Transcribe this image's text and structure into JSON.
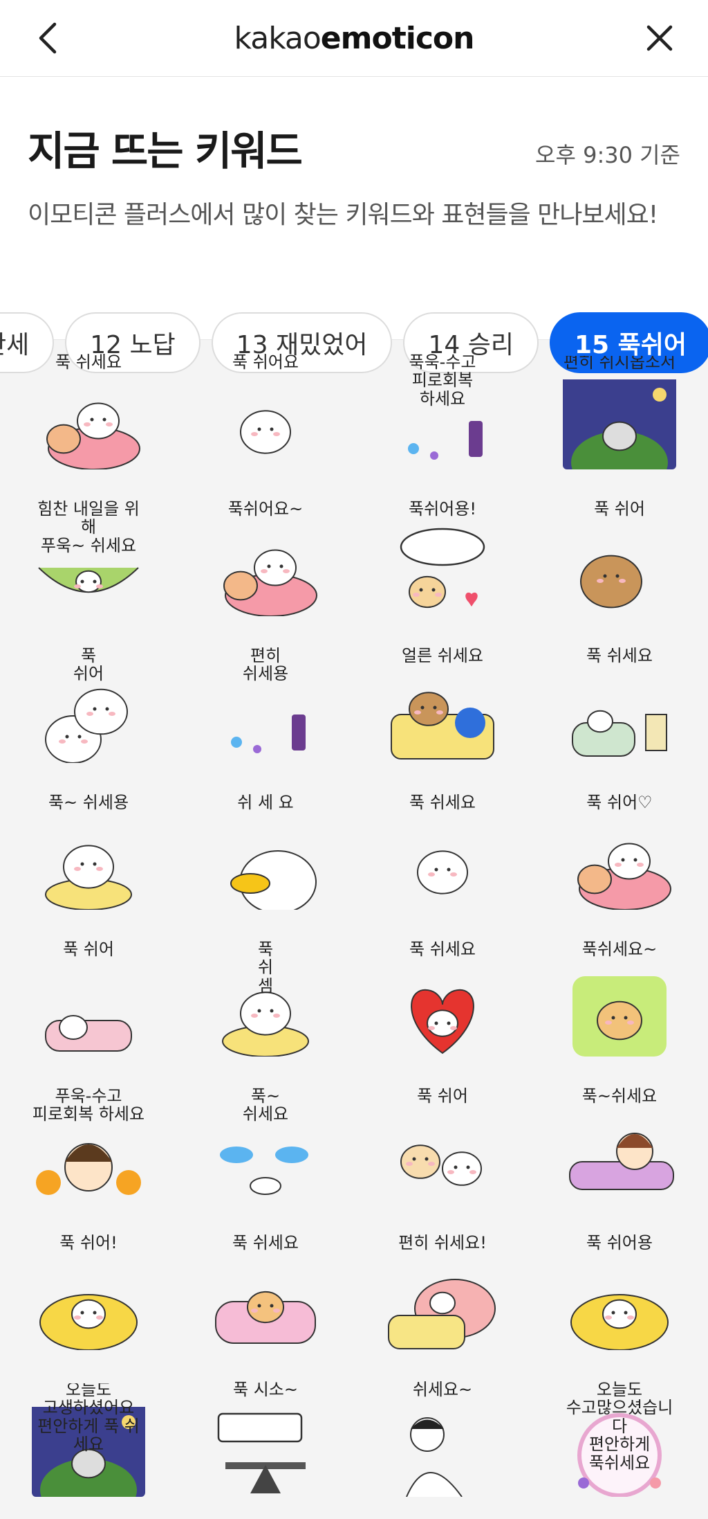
{
  "nav": {
    "brand_light": "kakao",
    "brand_bold": "emoticon"
  },
  "header": {
    "title": "지금 뜨는 키워드",
    "timestamp": "오후 9:30 기준",
    "subtitle": "이모티콘 플러스에서 많이 찾는 키워드와 표현들을 만나보세요!"
  },
  "chips": [
    {
      "label": "만세",
      "active": false
    },
    {
      "label": "12 노답",
      "active": false
    },
    {
      "label": "13 재밌었어",
      "active": false
    },
    {
      "label": "14 승리",
      "active": false
    },
    {
      "label": "15 푹쉬어",
      "active": true
    }
  ],
  "stickers": [
    {
      "caption": "푹 쉬세요",
      "art": "bear-bed"
    },
    {
      "caption": "푹 쉬어요",
      "art": "bear-cushion"
    },
    {
      "caption": "푹욱-수고\n피로회복\n하세요",
      "art": "text-drink"
    },
    {
      "caption": "편히 쉬시옵소서",
      "art": "night-sleeper"
    },
    {
      "caption": "힘찬 내일을 위해\n푸욱~ 쉬세요",
      "art": "hammock"
    },
    {
      "caption": "푹쉬어요~",
      "art": "bear-hug"
    },
    {
      "caption": "푹쉬어용!",
      "art": "puppy-bubble"
    },
    {
      "caption": "푹 쉬어",
      "art": "quokka"
    },
    {
      "caption": "푹\n쉬어",
      "art": "bears-pile"
    },
    {
      "caption": "편히\n쉬세용",
      "art": "text-colorful"
    },
    {
      "caption": "얼른 쉬세요",
      "art": "bear-blanket"
    },
    {
      "caption": "푹 쉬세요",
      "art": "rabbit-lamp"
    },
    {
      "caption": "푹~ 쉬세용",
      "art": "bear-tea"
    },
    {
      "caption": "쉬 세 요",
      "art": "duck"
    },
    {
      "caption": "푹 쉬세요",
      "art": "bear-small"
    },
    {
      "caption": "푹 쉬어♡",
      "art": "bear-pillow"
    },
    {
      "caption": "푹 쉬어",
      "art": "dog-sleep"
    },
    {
      "caption": "푹\n쉬\n셈",
      "art": "rabbit-tea"
    },
    {
      "caption": "푹 쉬세요",
      "art": "heart-sleep"
    },
    {
      "caption": "푹쉬세요~",
      "art": "bear-green"
    },
    {
      "caption": "푸욱-수고\n피로회복 하세요",
      "art": "girl-orange"
    },
    {
      "caption": "푹~\n쉬세요",
      "art": "clouds"
    },
    {
      "caption": "푹 쉬어",
      "art": "puppy-cat"
    },
    {
      "caption": "푹~쉬세요",
      "art": "girl-sofa"
    },
    {
      "caption": "푹 쉬어!",
      "art": "bear-yellow-bed"
    },
    {
      "caption": "푹 쉬세요",
      "art": "cat-bed"
    },
    {
      "caption": "편히 쉬세요!",
      "art": "strawberry-bed"
    },
    {
      "caption": "푹 쉬어용",
      "art": "cat-cushion"
    },
    {
      "caption": "오늘도\n고생하셨어요\n편안하게 푹 쉬세요",
      "art": "night-tea"
    },
    {
      "caption": "푹 시소~",
      "art": "seesaw"
    },
    {
      "caption": "쉬세요~",
      "art": "man-bow"
    },
    {
      "caption": "오늘도\n수고많으셨습니다\n편안하게\n푹쉬세요",
      "art": "flower-wreath"
    }
  ]
}
